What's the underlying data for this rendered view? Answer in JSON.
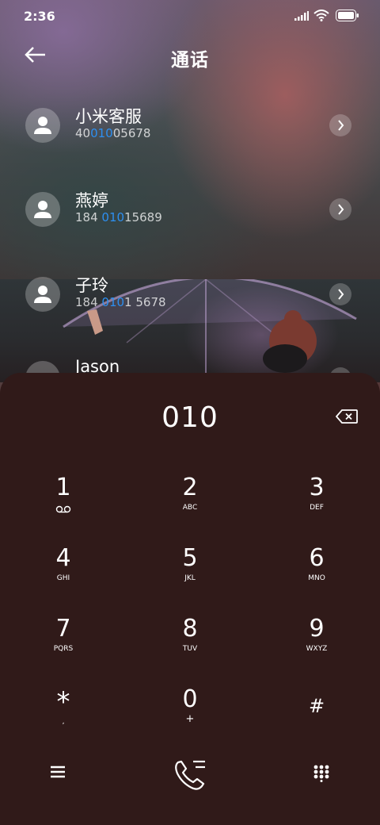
{
  "status": {
    "time": "2:36"
  },
  "header": {
    "title": "通话"
  },
  "contacts": [
    {
      "name": "小米客服",
      "num_pre": "40",
      "num_hl": "010",
      "num_post": "05678"
    },
    {
      "name": "燕婷",
      "num_pre": "184 ",
      "num_hl": "010",
      "num_post": "15689"
    },
    {
      "name": "子玲",
      "num_pre": "184 ",
      "num_hl": "010",
      "num_post": "1 5678"
    },
    {
      "name": "Jason",
      "num_pre": "",
      "num_hl": "",
      "num_post": ""
    }
  ],
  "dialer": {
    "number": "010",
    "keys": [
      {
        "digit": "1",
        "letters": ""
      },
      {
        "digit": "2",
        "letters": "ABC"
      },
      {
        "digit": "3",
        "letters": "DEF"
      },
      {
        "digit": "4",
        "letters": "GHI"
      },
      {
        "digit": "5",
        "letters": "JKL"
      },
      {
        "digit": "6",
        "letters": "MNO"
      },
      {
        "digit": "7",
        "letters": "PQRS"
      },
      {
        "digit": "8",
        "letters": "TUV"
      },
      {
        "digit": "9",
        "letters": "WXYZ"
      },
      {
        "digit": "*",
        "letters": ","
      },
      {
        "digit": "0",
        "letters": "+"
      },
      {
        "digit": "#",
        "letters": ""
      }
    ]
  },
  "colors": {
    "highlight": "#2d8ff0",
    "dialer_bg": "#301a19"
  }
}
